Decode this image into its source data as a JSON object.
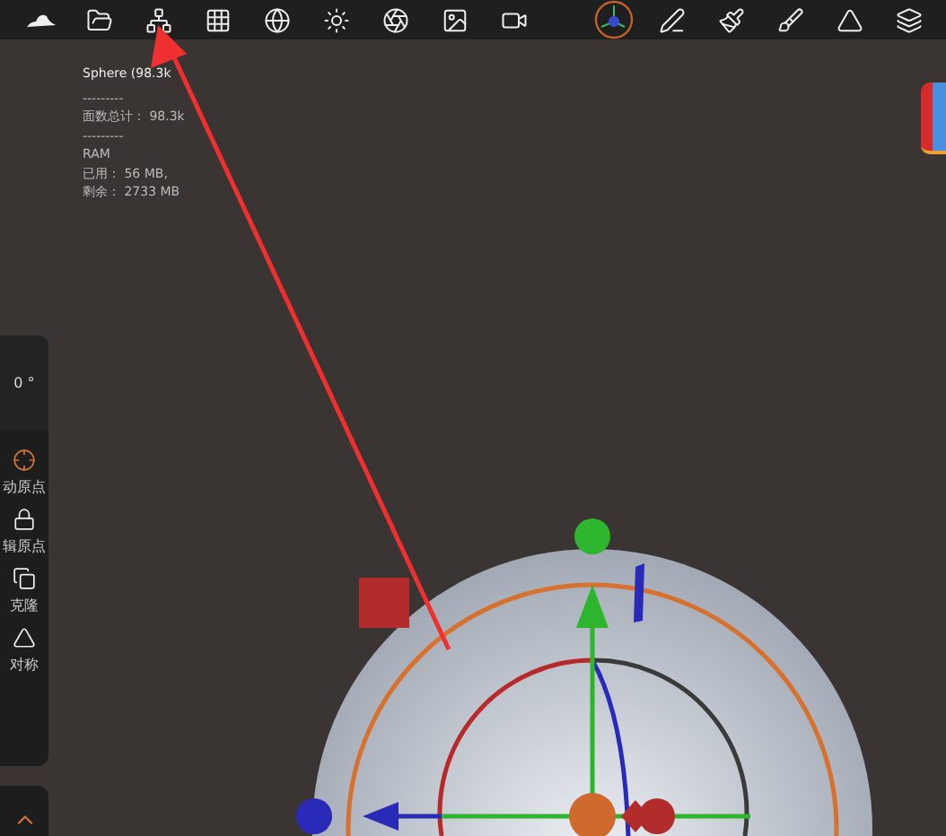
{
  "toolbar": {
    "items": [
      {
        "kind": "hat"
      },
      {
        "kind": "folder"
      },
      {
        "kind": "scene"
      },
      {
        "kind": "grid"
      },
      {
        "kind": "mesh"
      },
      {
        "kind": "light"
      },
      {
        "kind": "aperture"
      },
      {
        "kind": "image"
      },
      {
        "kind": "video"
      },
      {
        "kind": "gizmo"
      },
      {
        "kind": "pen"
      },
      {
        "kind": "brush"
      },
      {
        "kind": "paint"
      },
      {
        "kind": "symmetry"
      },
      {
        "kind": "layers"
      }
    ]
  },
  "info": {
    "lines": [
      "Sphere (98.3k",
      "---------",
      "面数总计： 98.3k",
      "---------",
      "RAM",
      "已用： 56 MB,",
      "剩余： 2733 MB"
    ]
  },
  "side_panel": {
    "angle": "0 °",
    "tools": [
      {
        "kind": "crosshair",
        "label": "动原点"
      },
      {
        "kind": "lock",
        "label": "辑原点"
      },
      {
        "kind": "copy",
        "label": "克隆"
      },
      {
        "kind": "mirror",
        "label": "对称"
      }
    ]
  }
}
